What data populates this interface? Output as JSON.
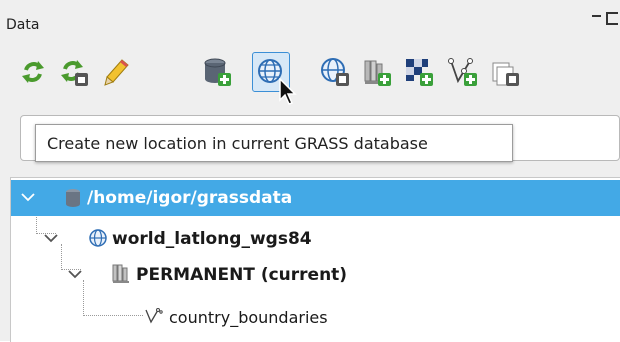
{
  "panel": {
    "title": "Data"
  },
  "toolbar": {
    "tooltip": "Create new location in current GRASS database"
  },
  "tree": {
    "database": "/home/igor/grassdata",
    "location": "world_latlong_wgs84",
    "mapset": "PERMANENT  (current)",
    "vector": "country_boundaries"
  },
  "colors": {
    "selection": "#43a9e6",
    "hover_border": "#3b8fd6",
    "green_badge": "#3aa03a"
  },
  "icons": [
    "reload-grass-db-icon",
    "reload-mapset-icon",
    "edit-pencil-icon",
    "add-database-icon",
    "create-location-icon",
    "download-location-icon",
    "create-mapset-icon",
    "import-raster-icon",
    "import-vector-icon",
    "link-layer-icon"
  ]
}
